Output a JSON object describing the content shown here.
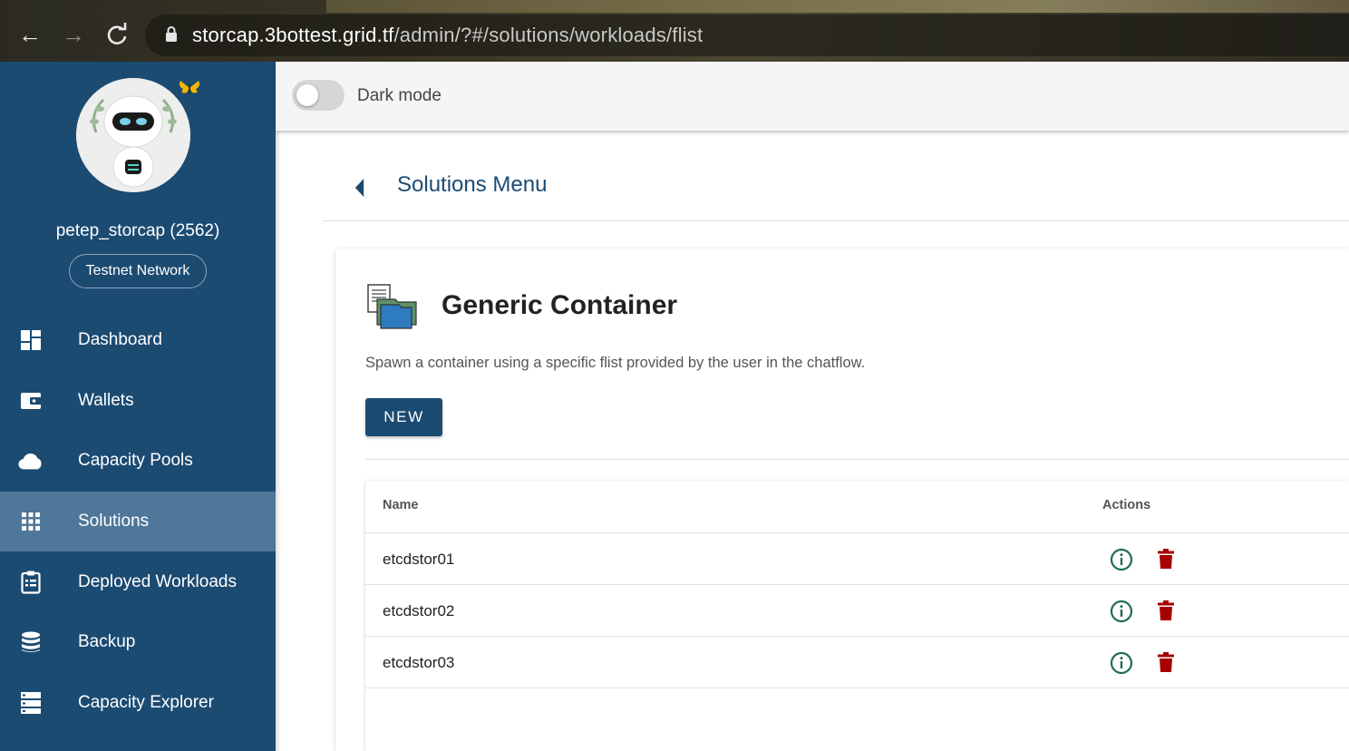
{
  "browser": {
    "url_host": "storcap.3bottest.grid.tf",
    "url_path": "/admin/?#/solutions/workloads/flist"
  },
  "sidebar": {
    "user_name": "petep_storcap (2562)",
    "network": "Testnet Network",
    "items": [
      {
        "label": "Dashboard",
        "icon": "dashboard-icon"
      },
      {
        "label": "Wallets",
        "icon": "wallet-icon"
      },
      {
        "label": "Capacity Pools",
        "icon": "cloud-icon"
      },
      {
        "label": "Solutions",
        "icon": "apps-grid-icon",
        "active": true
      },
      {
        "label": "Deployed Workloads",
        "icon": "clipboard-list-icon"
      },
      {
        "label": "Backup",
        "icon": "database-icon"
      },
      {
        "label": "Capacity Explorer",
        "icon": "server-icon"
      }
    ]
  },
  "topbar": {
    "dark_mode_label": "Dark mode",
    "dark_mode_on": false
  },
  "main": {
    "breadcrumb_title": "Solutions Menu",
    "solution_title": "Generic Container",
    "solution_description": "Spawn a container using a specific flist provided by the user in the chatflow.",
    "new_button": "NEW",
    "table": {
      "headers": {
        "name": "Name",
        "actions": "Actions"
      },
      "rows": [
        {
          "name": "etcdstor01"
        },
        {
          "name": "etcdstor02"
        },
        {
          "name": "etcdstor03"
        }
      ]
    }
  },
  "colors": {
    "primary": "#1c4b72",
    "sidebar_active": "#4e779a",
    "info": "#1e6b5a",
    "delete": "#a80000"
  }
}
